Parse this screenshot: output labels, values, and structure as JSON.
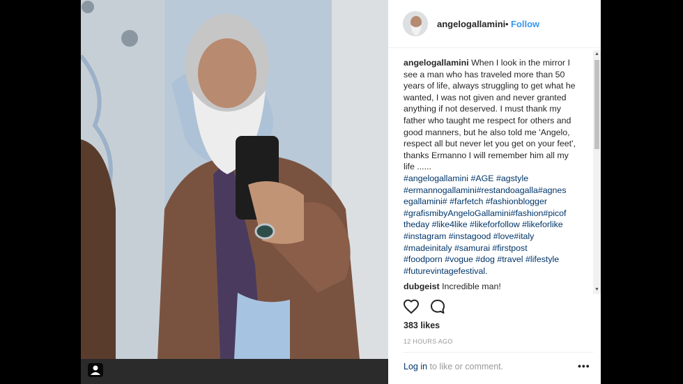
{
  "post": {
    "username": "angelogallamini",
    "separator": "•",
    "follow_label": "Follow",
    "caption": {
      "username": "angelogallamini",
      "text": "When I look in the mirror I see a man who has traveled more than 50 years of life, always struggling to get what he wanted, I was not given and never granted anything if not deserved. I must thank my father who taught me respect for others and good manners, but he also told me 'Angelo, respect all but never let you get on your feet', thanks Ermanno I will remember him all my life ......",
      "hashtags_line1": "#angelogallamini #AGE #agstyle",
      "hashtags_line2": "#ermannogallamini#restandoagalla#agnes",
      "hashtags_line3": "egallamini# #farfetch #fashionblogger",
      "hashtags_line4": "#grafismibyAngeloGallamini#fashion#picof",
      "hashtags_line5": "theday #like4like #likeforfollow #likeforlike",
      "hashtags_line6": "#instagram #instagood #love#italy",
      "hashtags_line7": "#madeinitaly #samurai #firstpost",
      "hashtags_line8": "#foodporn #vogue #dog #travel #lifestyle",
      "hashtags_line9": "#futurevintagefestival",
      "end": "."
    },
    "comment": {
      "username": "dubgeist",
      "text": "Incredible man!"
    },
    "likes": "383 likes",
    "time": "12 HOURS AGO",
    "login_link": "Log in",
    "login_rest": " to like or comment.",
    "more_label": "•••"
  },
  "icons": {
    "like": "heart-icon",
    "comment": "comment-bubble-icon",
    "tagged_user": "user-tag-icon",
    "scroll_up": "chevron-up-icon",
    "scroll_down": "chevron-down-icon"
  }
}
